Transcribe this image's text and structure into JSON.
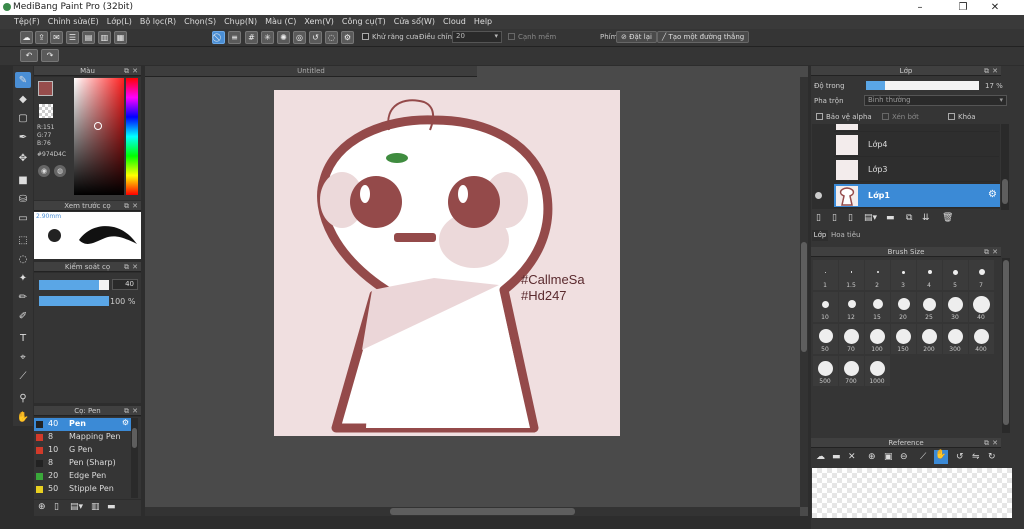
{
  "window": {
    "title": "MediBang Paint Pro (32bit)",
    "min": "–",
    "max": "❐",
    "close": "✕"
  },
  "menu": [
    "Tệp(F)",
    "Chỉnh sửa(E)",
    "Lớp(L)",
    "Bộ lọc(R)",
    "Chọn(S)",
    "Chụp(N)",
    "Màu (C)",
    "Xem(V)",
    "Công cụ(T)",
    "Cửa sổ(W)",
    "Cloud",
    "Help"
  ],
  "toolbar": {
    "antialias": "Khử răng cưa",
    "adjust_label": "Điều chỉnh",
    "adjust_value": "20",
    "edge_mode": "Cạnh mềm",
    "key_label": "Phím",
    "reset": "Đặt lại",
    "create_line": "Tạo một đường thẳng"
  },
  "color_panel": {
    "title": "Màu",
    "r": "R:151",
    "g": "G:77",
    "b": "B:76",
    "hex": "#974D4C",
    "main_color": "#974d4c"
  },
  "brush_preview": {
    "title": "Xem trước cọ",
    "size": "2.90mm"
  },
  "brush_control": {
    "title": "Kiểm soát cọ",
    "size_value": "40",
    "opacity_value": "100 %",
    "size_fraction": 0.85,
    "opacity_fraction": 1.0
  },
  "brush_list": {
    "title": "Cọ: Pen",
    "items": [
      {
        "size": "40",
        "name": "Pen",
        "color": "#222222"
      },
      {
        "size": "8",
        "name": "Mapping Pen",
        "color": "#d23a2a"
      },
      {
        "size": "10",
        "name": "G Pen",
        "color": "#d23a2a"
      },
      {
        "size": "8",
        "name": "Pen (Sharp)",
        "color": "#222222"
      },
      {
        "size": "20",
        "name": "Edge Pen",
        "color": "#3aa83a"
      },
      {
        "size": "50",
        "name": "Stipple Pen",
        "color": "#e8d020"
      }
    ]
  },
  "document": {
    "tab": "Untitled",
    "text1": "#CallmeSa",
    "text2": "#Hd247"
  },
  "layer_panel": {
    "title": "Lớp",
    "opacity_label": "Độ trong",
    "opacity_value": "17 %",
    "opacity_fraction": 0.17,
    "blend_label": "Pha trộn",
    "blend_value": "Bình thường",
    "protect_alpha": "Bảo vệ alpha",
    "clipping": "Xén bớt",
    "lock": "Khóa",
    "layers": [
      "Lớp4",
      "Lớp3",
      "Lớp1"
    ],
    "tab1": "Lớp",
    "tab2": "Hoa tiêu"
  },
  "brush_size": {
    "title": "Brush Size",
    "sizes": [
      "1",
      "1.5",
      "2",
      "3",
      "4",
      "5",
      "7",
      "10",
      "12",
      "15",
      "20",
      "25",
      "30",
      "40",
      "50",
      "70",
      "100",
      "150",
      "200",
      "300",
      "400",
      "500",
      "700",
      "1000"
    ]
  },
  "reference": {
    "title": "Reference"
  }
}
